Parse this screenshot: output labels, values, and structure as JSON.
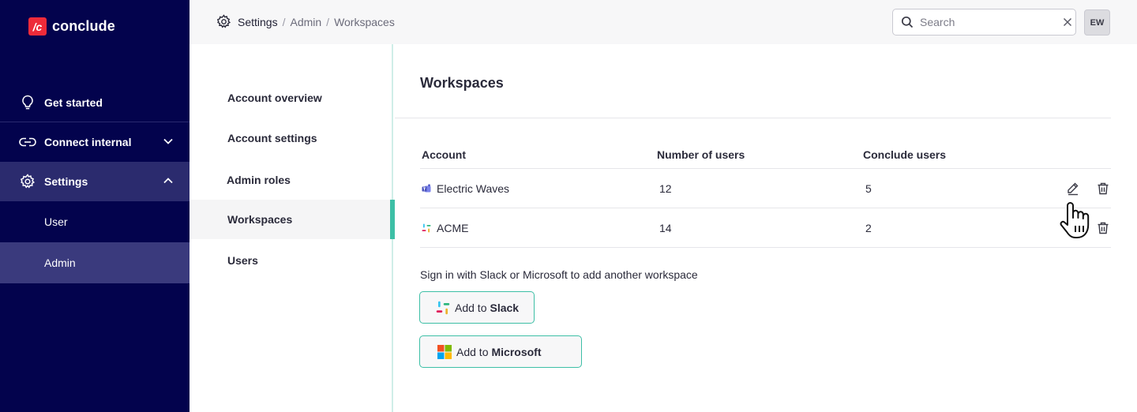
{
  "brand": {
    "mark": "/c",
    "name": "conclude"
  },
  "sidebar": {
    "items": [
      {
        "label": "Get started",
        "icon": "lightbulb-icon"
      },
      {
        "label": "Connect internal",
        "icon": "link-icon",
        "expanded": false
      },
      {
        "label": "Settings",
        "icon": "gear-icon",
        "expanded": true
      }
    ],
    "sub_items": [
      {
        "label": "User"
      },
      {
        "label": "Admin",
        "active": true
      }
    ]
  },
  "breadcrumb": {
    "items": [
      "Settings",
      "Admin",
      "Workspaces"
    ]
  },
  "search": {
    "placeholder": "Search",
    "value": ""
  },
  "avatar": {
    "initials": "EW"
  },
  "subnav": {
    "items": [
      {
        "label": "Account overview"
      },
      {
        "label": "Account settings"
      },
      {
        "label": "Admin roles"
      },
      {
        "label": "Workspaces",
        "active": true
      },
      {
        "label": "Users"
      }
    ]
  },
  "main": {
    "title": "Workspaces",
    "table": {
      "headers": [
        "Account",
        "Number of users",
        "Conclude users"
      ],
      "rows": [
        {
          "account": "Electric Waves",
          "platform": "teams-icon",
          "users": "12",
          "conclude_users": "5"
        },
        {
          "account": "ACME",
          "platform": "slack-icon",
          "users": "14",
          "conclude_users": "2"
        }
      ]
    },
    "hint": "Sign in with Slack or Microsoft to add another workspace",
    "add_slack": {
      "prefix": "Add to",
      "brand": "Slack"
    },
    "add_microsoft": {
      "prefix": "Add to",
      "brand": "Microsoft"
    }
  },
  "colors": {
    "sidebar_bg": "#03034d",
    "accent": "#3dbfa6",
    "brand_red": "#ee2b3a"
  }
}
